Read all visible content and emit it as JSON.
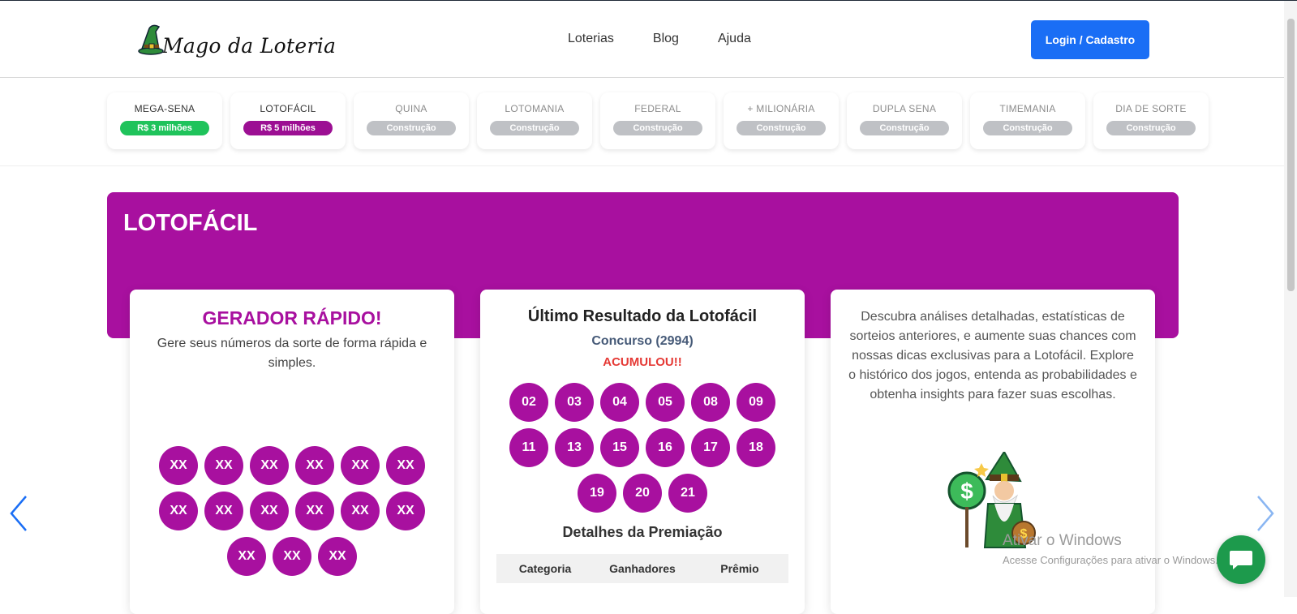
{
  "header": {
    "logo_text": "Mago da Loteria",
    "nav": [
      "Loterias",
      "Blog",
      "Ajuda"
    ],
    "login_label": "Login / Cadastro"
  },
  "lotteries": [
    {
      "name": "MEGA-SENA",
      "badge": "R$ 3 milhões",
      "color": "#1fc35b",
      "active": true
    },
    {
      "name": "LOTOFÁCIL",
      "badge": "R$ 5 milhões",
      "color": "#9c0f93",
      "active": true
    },
    {
      "name": "QUINA",
      "badge": "Construção",
      "active": false
    },
    {
      "name": "LOTOMANIA",
      "badge": "Construção",
      "active": false
    },
    {
      "name": "FEDERAL",
      "badge": "Construção",
      "active": false
    },
    {
      "name": "+ MILIONÁRIA",
      "badge": "Construção",
      "active": false
    },
    {
      "name": "DUPLA SENA",
      "badge": "Construção",
      "active": false
    },
    {
      "name": "TIMEMANIA",
      "badge": "Construção",
      "active": false
    },
    {
      "name": "DIA DE SORTE",
      "badge": "Construção",
      "active": false
    }
  ],
  "banner": {
    "title": "LOTOFÁCIL",
    "color": "#a8109f"
  },
  "generator": {
    "title": "GERADOR RÁPIDO!",
    "description": "Gere seus números da sorte de forma rápida e simples.",
    "balls": [
      "XX",
      "XX",
      "XX",
      "XX",
      "XX",
      "XX",
      "XX",
      "XX",
      "XX",
      "XX",
      "XX",
      "XX",
      "XX",
      "XX",
      "XX"
    ]
  },
  "result": {
    "title": "Último Resultado da Lotofácil",
    "contest": "Concurso (2994)",
    "status": "ACUMULOU!!",
    "numbers": [
      "02",
      "03",
      "04",
      "05",
      "08",
      "09",
      "11",
      "13",
      "15",
      "16",
      "17",
      "18",
      "19",
      "20",
      "21"
    ],
    "details_title": "Detalhes da Premiação",
    "table_headers": [
      "Categoria",
      "Ganhadores",
      "Prêmio"
    ]
  },
  "info": {
    "text": "Descubra análises detalhadas, estatísticas de sorteios anteriores, e aumente suas chances com nossas dicas exclusivas para a Lotofácil. Explore o histórico dos jogos, entenda as probabilidades e obtenha insights para fazer suas escolhas."
  },
  "watermark": {
    "line1": "Ativar o Windows",
    "line2": "Acesse Configurações para ativar o Windows."
  },
  "icons": {
    "logo": "wizard-hat-icon",
    "mascot": "wizard-mascot-icon",
    "prev": "chevron-left-icon",
    "next": "chevron-right-icon",
    "chat": "chat-bubble-icon"
  }
}
